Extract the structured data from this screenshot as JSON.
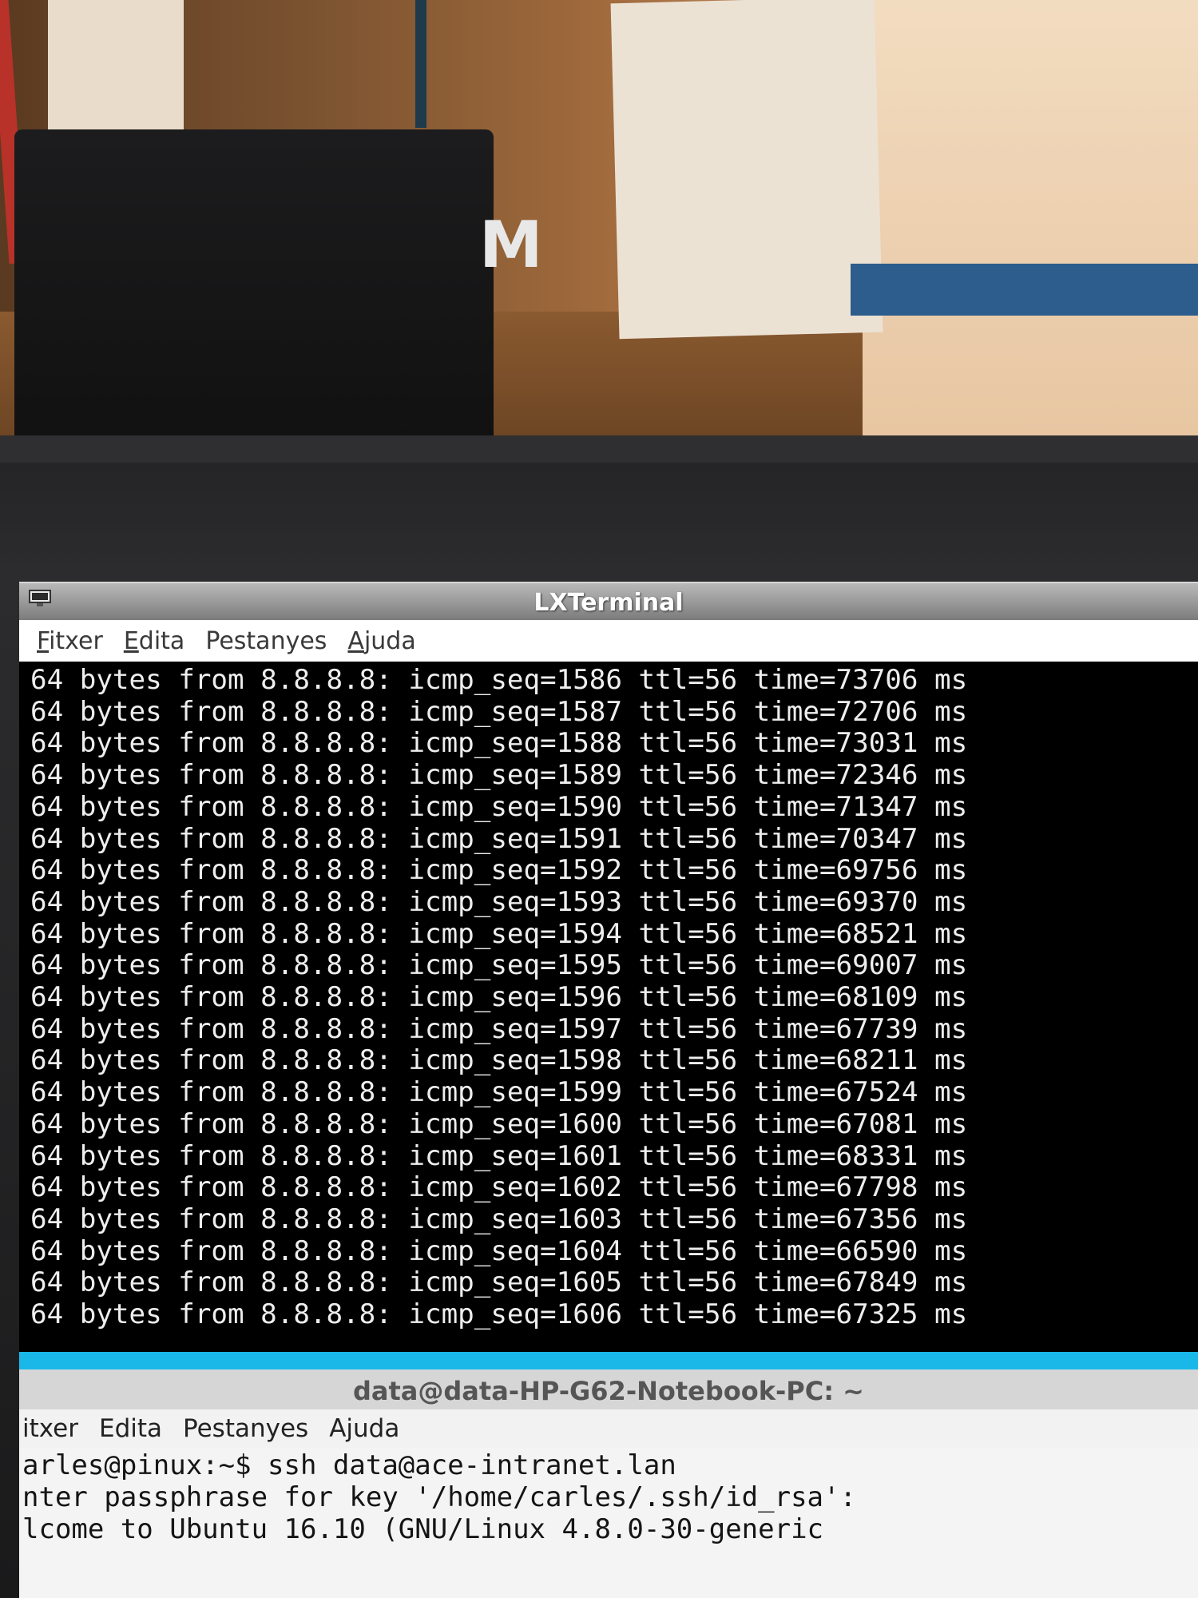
{
  "window": {
    "title": "LXTerminal",
    "menu": [
      "Fitxer",
      "Edita",
      "Pestanyes",
      "Ajuda"
    ]
  },
  "terminal": {
    "lines": [
      "64 bytes from 8.8.8.8: icmp_seq=1586 ttl=56 time=73706 ms",
      "64 bytes from 8.8.8.8: icmp_seq=1587 ttl=56 time=72706 ms",
      "64 bytes from 8.8.8.8: icmp_seq=1588 ttl=56 time=73031 ms",
      "64 bytes from 8.8.8.8: icmp_seq=1589 ttl=56 time=72346 ms",
      "64 bytes from 8.8.8.8: icmp_seq=1590 ttl=56 time=71347 ms",
      "64 bytes from 8.8.8.8: icmp_seq=1591 ttl=56 time=70347 ms",
      "64 bytes from 8.8.8.8: icmp_seq=1592 ttl=56 time=69756 ms",
      "64 bytes from 8.8.8.8: icmp_seq=1593 ttl=56 time=69370 ms",
      "64 bytes from 8.8.8.8: icmp_seq=1594 ttl=56 time=68521 ms",
      "64 bytes from 8.8.8.8: icmp_seq=1595 ttl=56 time=69007 ms",
      "64 bytes from 8.8.8.8: icmp_seq=1596 ttl=56 time=68109 ms",
      "64 bytes from 8.8.8.8: icmp_seq=1597 ttl=56 time=67739 ms",
      "64 bytes from 8.8.8.8: icmp_seq=1598 ttl=56 time=68211 ms",
      "64 bytes from 8.8.8.8: icmp_seq=1599 ttl=56 time=67524 ms",
      "64 bytes from 8.8.8.8: icmp_seq=1600 ttl=56 time=67081 ms",
      "64 bytes from 8.8.8.8: icmp_seq=1601 ttl=56 time=68331 ms",
      "64 bytes from 8.8.8.8: icmp_seq=1602 ttl=56 time=67798 ms",
      "64 bytes from 8.8.8.8: icmp_seq=1603 ttl=56 time=67356 ms",
      "64 bytes from 8.8.8.8: icmp_seq=1604 ttl=56 time=66590 ms",
      "64 bytes from 8.8.8.8: icmp_seq=1605 ttl=56 time=67849 ms",
      "64 bytes from 8.8.8.8: icmp_seq=1606 ttl=56 time=67325 ms"
    ],
    "cursor": "I"
  },
  "window2": {
    "title": "data@data-HP-G62-Notebook-PC: ~",
    "menu": [
      "itxer",
      "Edita",
      "Pestanyes",
      "Ajuda"
    ],
    "lines": [
      "arles@pinux:~$ ssh data@ace-intranet.lan",
      "nter passphrase for key '/home/carles/.ssh/id_rsa':",
      "lcome to Ubuntu 16.10 (GNU/Linux 4.8.0-30-generic"
    ]
  },
  "scene": {
    "monitor_logo": "M"
  }
}
